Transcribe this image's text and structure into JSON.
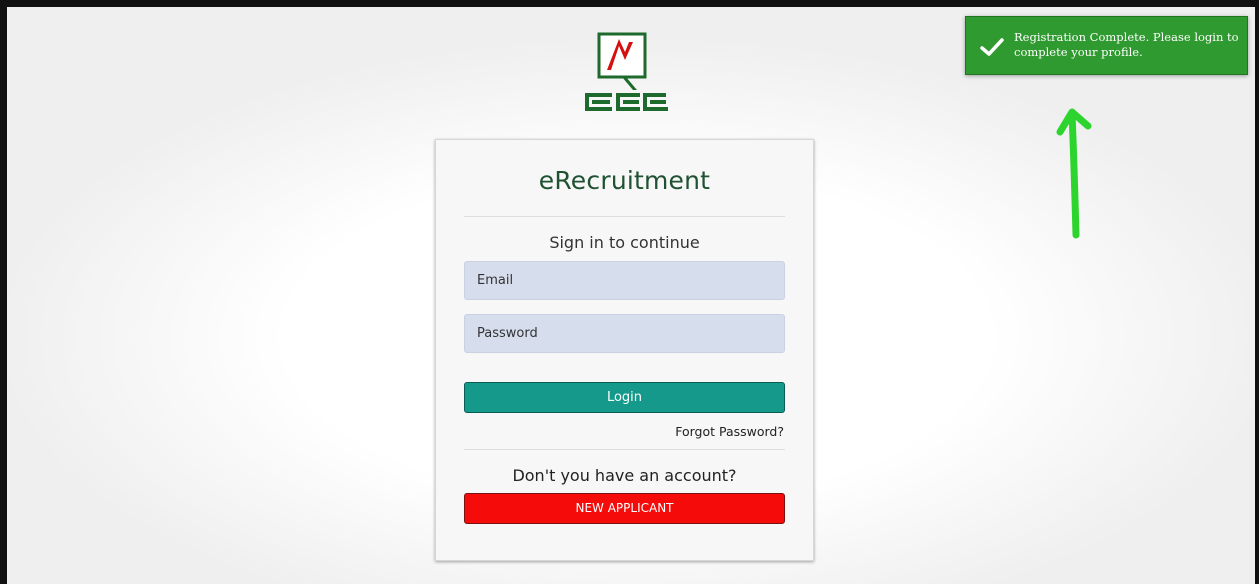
{
  "brand": {
    "title": "eRecruitment",
    "logo_icon": "ncc-logo-icon",
    "accent_color": "#1f5232"
  },
  "login": {
    "subtitle": "Sign in to continue",
    "email_placeholder": "Email",
    "password_placeholder": "Password",
    "login_label": "Login",
    "forgot_label": "Forgot Password?",
    "account_question": "Don't you have an account?",
    "new_applicant_label": "NEW APPLICANT",
    "login_color": "#14998a",
    "new_applicant_color": "#f60b0b"
  },
  "toast": {
    "message": "Registration Complete. Please login to complete your profile.",
    "icon": "checkmark-icon",
    "color": "#2f9a2f"
  },
  "annotation": {
    "icon": "green-arrow-icon",
    "color": "#2ed42e"
  }
}
